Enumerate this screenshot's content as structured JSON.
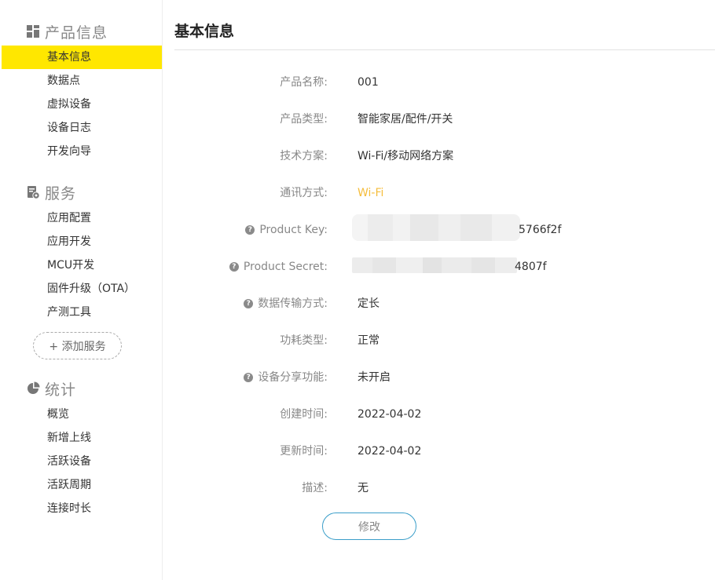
{
  "sidebar": {
    "sections": [
      {
        "title": "产品信息",
        "icon": "grid-icon",
        "items": [
          "基本信息",
          "数据点",
          "虚拟设备",
          "设备日志",
          "开发向导"
        ],
        "active_index": 0
      },
      {
        "title": "服务",
        "icon": "service-gear-icon",
        "items": [
          "应用配置",
          "应用开发",
          "MCU开发",
          "固件升级（OTA）",
          "产测工具"
        ]
      },
      {
        "title": "统计",
        "icon": "pie-chart-icon",
        "items": [
          "概览",
          "新增上线",
          "活跃设备",
          "活跃周期",
          "连接时长"
        ]
      }
    ],
    "add_service": "+ 添加服务",
    "active_color": "#ffe700"
  },
  "main": {
    "title": "基本信息",
    "fields": [
      {
        "label": "产品名称:",
        "value": "001"
      },
      {
        "label": "产品类型:",
        "value": "智能家居/配件/开关"
      },
      {
        "label": "技术方案:",
        "value": "Wi-Fi/移动网络方案"
      },
      {
        "label": "通讯方式:",
        "value": "Wi-Fi",
        "accent": true
      },
      {
        "label": "Product Key:",
        "value": "5766f2f",
        "help": true,
        "redacted": true
      },
      {
        "label": "Product Secret:",
        "value": "4807f",
        "help": true,
        "redacted": true
      },
      {
        "label": "数据传输方式:",
        "value": "定长",
        "help": true
      },
      {
        "label": "功耗类型:",
        "value": "正常"
      },
      {
        "label": "设备分享功能:",
        "value": "未开启",
        "help": true
      },
      {
        "label": "创建时间:",
        "value": "2022-04-02"
      },
      {
        "label": "更新时间:",
        "value": "2022-04-02"
      },
      {
        "label": "描述:",
        "value": "无"
      }
    ],
    "edit_button": "修改",
    "accent_color": "#f5bd3c",
    "button_border_color": "#3a9ec9"
  }
}
